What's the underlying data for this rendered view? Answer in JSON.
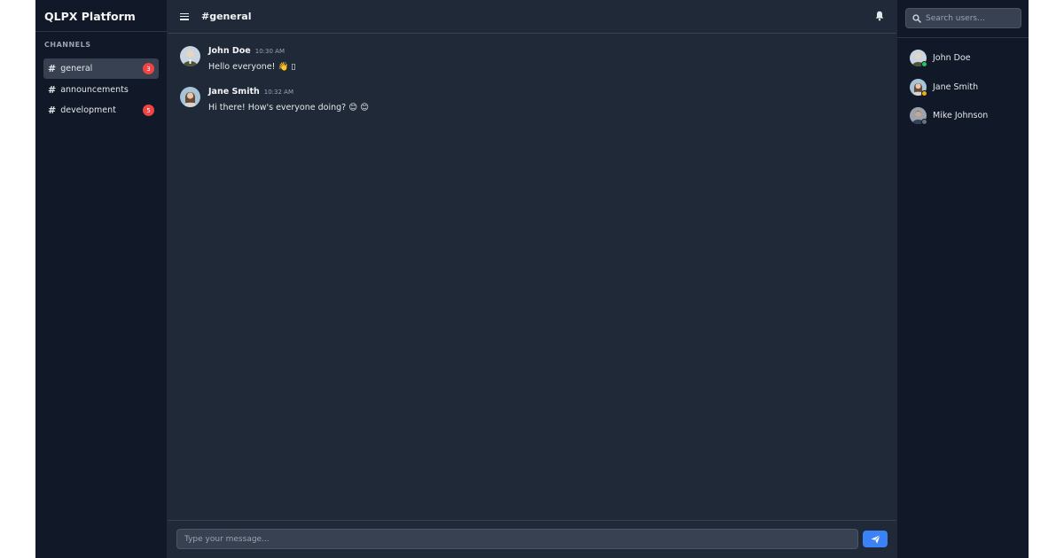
{
  "app": {
    "title": "QLPX Platform"
  },
  "sidebar": {
    "section_label": "CHANNELS",
    "channels": [
      {
        "label": "general",
        "badge": "3",
        "active": true
      },
      {
        "label": "announcements",
        "badge": "",
        "active": false
      },
      {
        "label": "development",
        "badge": "5",
        "active": false
      }
    ]
  },
  "header": {
    "channel_title": "#general"
  },
  "messages": [
    {
      "author": "John Doe",
      "time": "10:30 AM",
      "text": "Hello everyone! 👋 ▯"
    },
    {
      "author": "Jane Smith",
      "time": "10:32 AM",
      "text": "Hi there! How's everyone doing? 😊 😊"
    }
  ],
  "composer": {
    "placeholder": "Type your message..."
  },
  "users_panel": {
    "search_placeholder": "Search users...",
    "users": [
      {
        "name": "John Doe",
        "status": "online",
        "status_color": "#22c55e"
      },
      {
        "name": "Jane Smith",
        "status": "away",
        "status_color": "#eab308"
      },
      {
        "name": "Mike Johnson",
        "status": "offline",
        "status_color": "#6b7280"
      }
    ]
  },
  "colors": {
    "accent": "#3b82f6",
    "badge": "#ef4444",
    "sidebar_bg": "#111827",
    "main_bg": "#1f2937"
  }
}
